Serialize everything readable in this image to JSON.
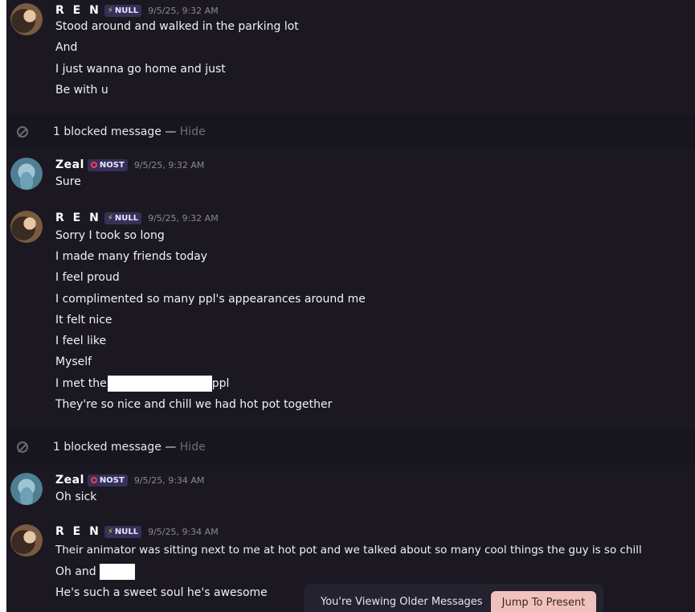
{
  "messages": [
    {
      "author": "R E N",
      "tag": "NULL",
      "tag_icon": "bolt-icon",
      "time": "9/5/25, 9:32 AM",
      "lines": [
        "Stood around and walked in the parking lot",
        "And",
        "I just wanna go home and just",
        "Be with u"
      ]
    },
    {
      "blocked": true,
      "text": "1 blocked message —",
      "action": "Hide"
    },
    {
      "author": "Zeal",
      "tag": "NOST",
      "tag_icon": "ring-icon",
      "time": "9/5/25, 9:32 AM",
      "lines": [
        "Sure"
      ]
    },
    {
      "author": "R E N",
      "tag": "NULL",
      "tag_icon": "bolt-icon",
      "time": "9/5/25, 9:32 AM",
      "lines": [
        "Sorry I took so long",
        "I made many friends today",
        "I feel proud",
        "I complimented so many ppl's appearances around me",
        "It felt nice",
        "I feel like",
        "Myself",
        "I met the",
        "They're so nice and chill we had hot pot together"
      ],
      "line8_suffix": "ppl"
    },
    {
      "blocked": true,
      "text": "1 blocked message —",
      "action": "Hide"
    },
    {
      "author": "Zeal",
      "tag": "NOST",
      "tag_icon": "ring-icon",
      "time": "9/5/25, 9:34 AM",
      "lines": [
        "Oh sick"
      ]
    },
    {
      "author": "R E N",
      "tag": "NULL",
      "tag_icon": "bolt-icon",
      "time": "9/5/25, 9:34 AM",
      "lines": [
        "Their animator was sitting next to me at hot pot and we talked about so many cool things the guy is so chill",
        "Oh and",
        "He's such a sweet soul he's awesome"
      ]
    }
  ],
  "banner": {
    "text": "You're Viewing Older Messages",
    "button": "Jump To Present"
  },
  "colors": {
    "background": "#1b1822",
    "blocked_band": "#17161f",
    "jump_button": "#f0c1bd",
    "tag_bg": "#35315a"
  }
}
